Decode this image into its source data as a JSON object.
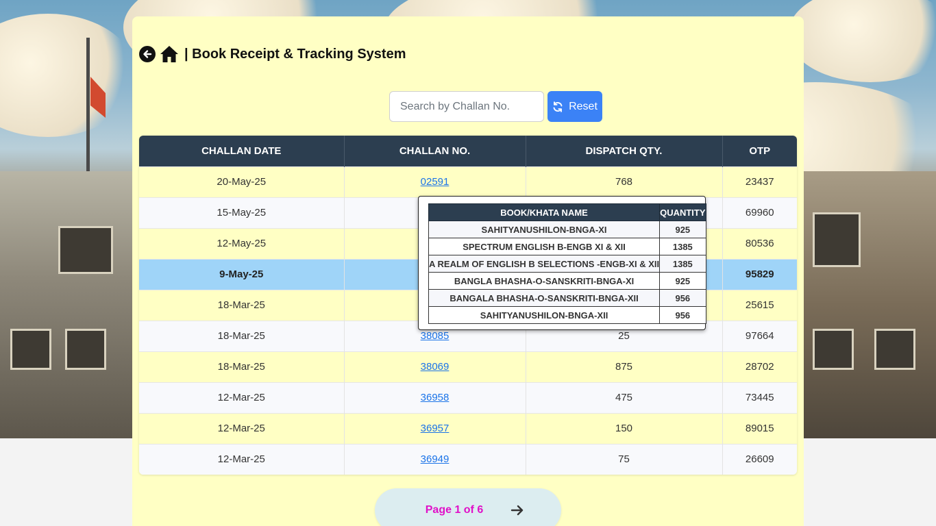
{
  "header": {
    "title": "| Book Receipt & Tracking System",
    "back_icon": "arrow-left-circle-icon",
    "home_icon": "home-icon"
  },
  "search": {
    "placeholder": "Search by Challan No.",
    "value": "",
    "reset_label": "Reset",
    "reset_icon": "refresh-icon"
  },
  "table": {
    "columns": [
      "CHALLAN DATE",
      "CHALLAN NO.",
      "DISPATCH QTY.",
      "OTP"
    ],
    "rows": [
      {
        "date": "20-May-25",
        "challan": "02591",
        "qty": "768",
        "otp": "23437"
      },
      {
        "date": "15-May-25",
        "challan": "",
        "qty": "",
        "otp": "69960"
      },
      {
        "date": "12-May-25",
        "challan": "",
        "qty": "",
        "otp": "80536"
      },
      {
        "date": "9-May-25",
        "challan": "",
        "qty": "",
        "otp": "95829"
      },
      {
        "date": "18-Mar-25",
        "challan": "",
        "qty": "",
        "otp": "25615"
      },
      {
        "date": "18-Mar-25",
        "challan": "38085",
        "qty": "25",
        "otp": "97664"
      },
      {
        "date": "18-Mar-25",
        "challan": "38069",
        "qty": "875",
        "otp": "28702"
      },
      {
        "date": "12-Mar-25",
        "challan": "36958",
        "qty": "475",
        "otp": "73445"
      },
      {
        "date": "12-Mar-25",
        "challan": "36957",
        "qty": "150",
        "otp": "89015"
      },
      {
        "date": "12-Mar-25",
        "challan": "36949",
        "qty": "75",
        "otp": "26609"
      }
    ]
  },
  "popup": {
    "columns": [
      "BOOK/KHATA NAME",
      "QUANTITY"
    ],
    "rows": [
      {
        "name": "SAHITYANUSHILON-BNGA-XI",
        "qty": "925"
      },
      {
        "name": "SPECTRUM ENGLISH B-ENGB XI & XII",
        "qty": "1385"
      },
      {
        "name": "A REALM OF ENGLISH B SELECTIONS -ENGB-XI & XII",
        "qty": "1385"
      },
      {
        "name": "BANGLA BHASHA-O-SANSKRITI-BNGA-XI",
        "qty": "925"
      },
      {
        "name": "BANGALA BHASHA-O-SANSKRITI-BNGA-XII",
        "qty": "956"
      },
      {
        "name": "SAHITYANUSHILON-BNGA-XII",
        "qty": "956"
      }
    ]
  },
  "pager": {
    "text": "Page 1 of 6",
    "next_icon": "arrow-right-icon"
  },
  "colors": {
    "card_bg": "#ffffc4",
    "header_bg": "#2c3e50",
    "selected_row": "#9fd4f8",
    "link": "#1a73e8",
    "reset_button": "#3b82f6",
    "page_text": "#e010c8"
  }
}
